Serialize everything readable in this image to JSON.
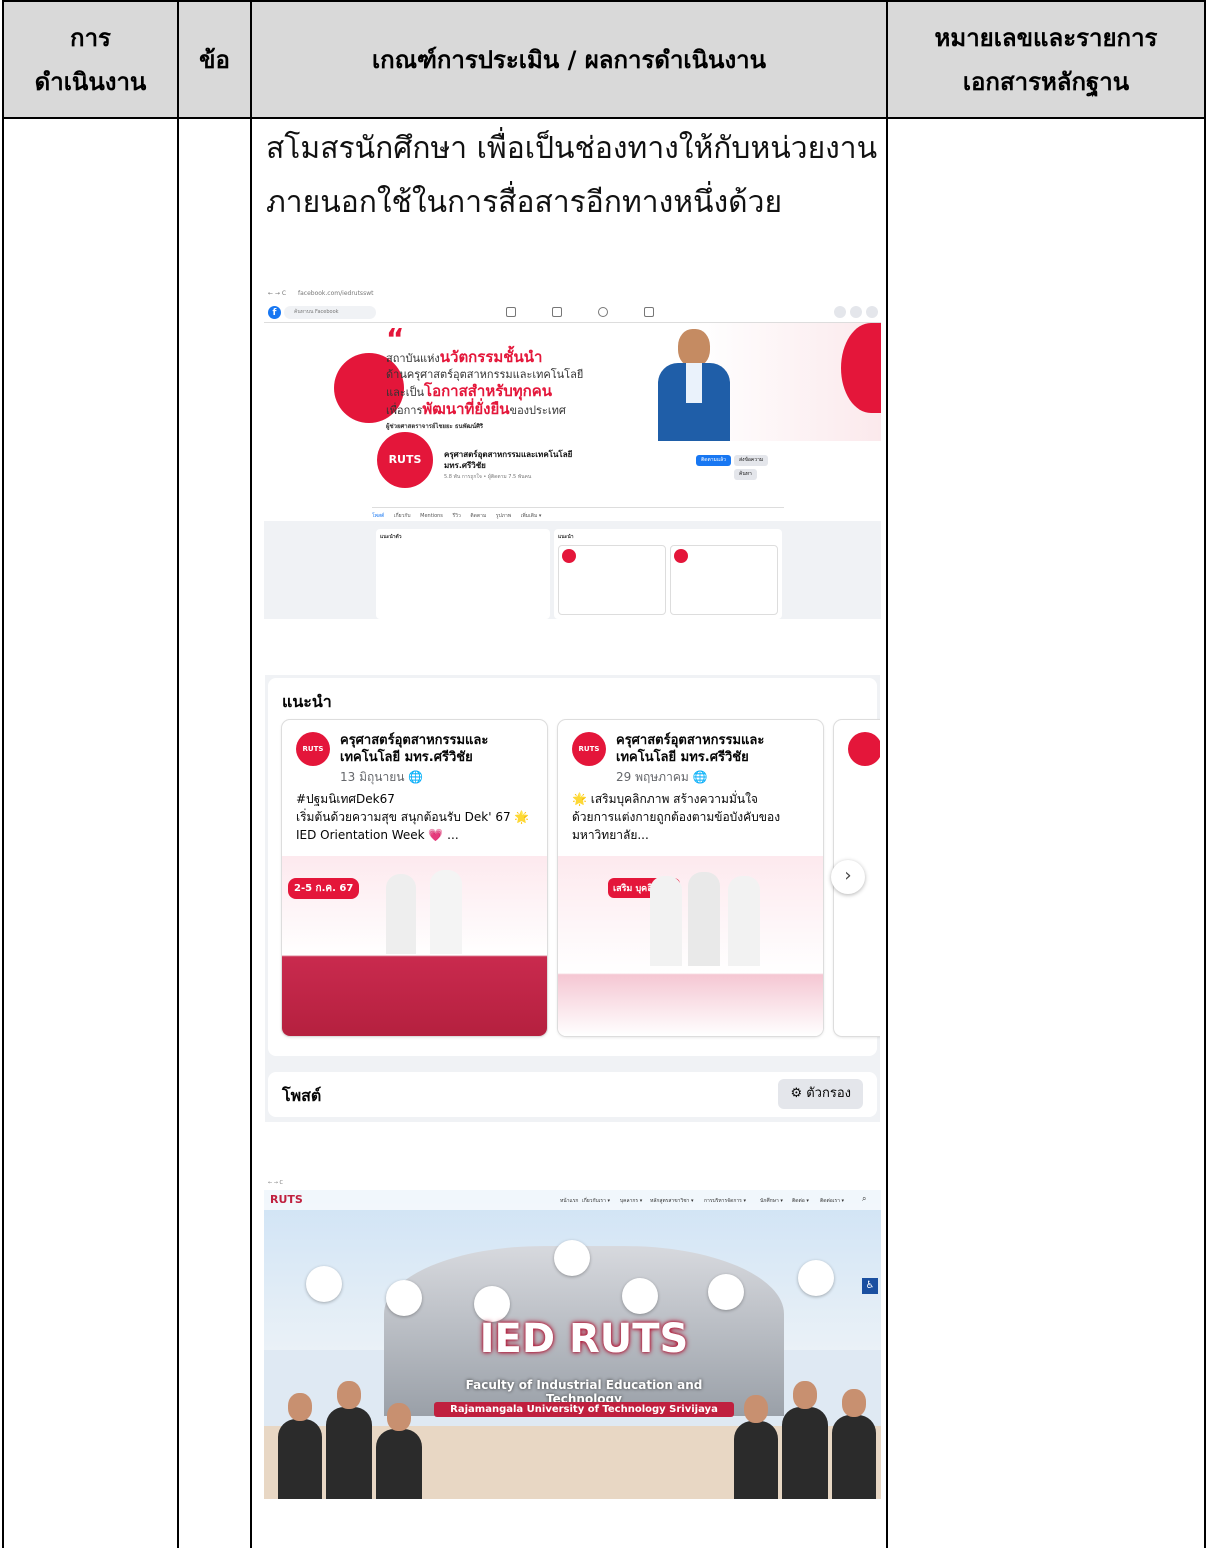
{
  "table": {
    "headers": {
      "col1": [
        "การ",
        "ดำเนินงาน"
      ],
      "col2": "ข้อ",
      "col3": "เกณฑ์การประเมิน / ผลการดำเนินงาน",
      "col4": [
        "หมายเลขและรายการ",
        "เอกสารหลักฐาน"
      ]
    },
    "body_lines": [
      "สโมสรนักศึกษา เพื่อเป็นช่องทางให้กับหน่วยงาน",
      "ภายนอกใช้ในการสื่อสารอีกทางหนึ่งด้วย"
    ]
  },
  "facebook_page": {
    "address": "facebook.com/iedrutsswt",
    "search_placeholder": "ค้นหาบน Facebook",
    "cover_quote": [
      "สถาบันแห่ง",
      "นวัตกรรมชั้นนำ",
      "ด้านครุศาสตร์อุตสาหกรรมและเทคโนโลยี",
      "และเป็น",
      "โอกาสสำหรับทุกคน",
      "เพื่อการ",
      "พัฒนาที่ยั่งยืน",
      "ของประเทศ"
    ],
    "cover_author": "ผู้ช่วยศาสตราจารย์ไชยยะ ธนพัฒน์ศิริ",
    "page_name": [
      "ครุศาสตร์อุตสาหกรรมและเทคโนโลยี",
      "มทร.ศรีวิชัย"
    ],
    "page_meta": "5.8 พัน การถูกใจ • ผู้ติดตาม 7.5 พันคน",
    "follow_button": "ติดตามแล้ว",
    "message_button": "ส่งข้อความ",
    "search_button": "ค้นหา",
    "tabs": [
      "โพสต์",
      "เกี่ยวกับ",
      "Mentions",
      "รีวิว",
      "ติดตาม",
      "รูปภาพ",
      "เพิ่มเติม ▾"
    ],
    "intro_title": "แนะนำตัว",
    "rec_title": "แนะนำ"
  },
  "recommended": {
    "title": "แนะนำ",
    "cards": [
      {
        "name": "ครุศาสตร์อุตสาหกรรมและเทคโนโลยี มทร.ศรีวิชัย",
        "date": "13 มิถุนายน",
        "text": "#ปฐมนิเทศDek67\nเริ่มต้นด้วยความสุข สนุกต้อนรับ Dek' 67 🌟\nIED Orientation Week 💗 ...",
        "image_label": "2-5 ก.ค. 67"
      },
      {
        "name": "ครุศาสตร์อุตสาหกรรมและเทคโนโลยี มทร.ศรีวิชัย",
        "date": "29 พฤษภาคม",
        "text": "🌟 เสริมบุคลิกภาพ สร้างความมั่นใจ\nด้วยการแต่งกายถูกต้องตามข้อบังคับของ\nมหาวิทยาลัย...",
        "image_label": "เสริม บุคลิกภาพ"
      }
    ],
    "posts_title": "โพสต์",
    "filter_button": "ตัวกรอง"
  },
  "website": {
    "logo": "RUTS",
    "headline": "IED RUTS",
    "subtitle": "Faculty of Industrial Education and Technology",
    "university": "Rajamangala University of Technology Srivijaya",
    "nav_items": [
      "หน้าแรก",
      "เกี่ยวกับเรา ▾",
      "บุคลากร ▾",
      "หลักสูตรสาขาวิชา ▾",
      "การบริหารจัดการ ▾",
      "นักศึกษา ▾",
      "ติดต่อ ▾",
      "ติดต่อเรา ▾"
    ]
  },
  "colors": {
    "header_bg": "#d9d9d9",
    "brand_red": "#e4163a",
    "facebook_blue": "#1877f2"
  }
}
